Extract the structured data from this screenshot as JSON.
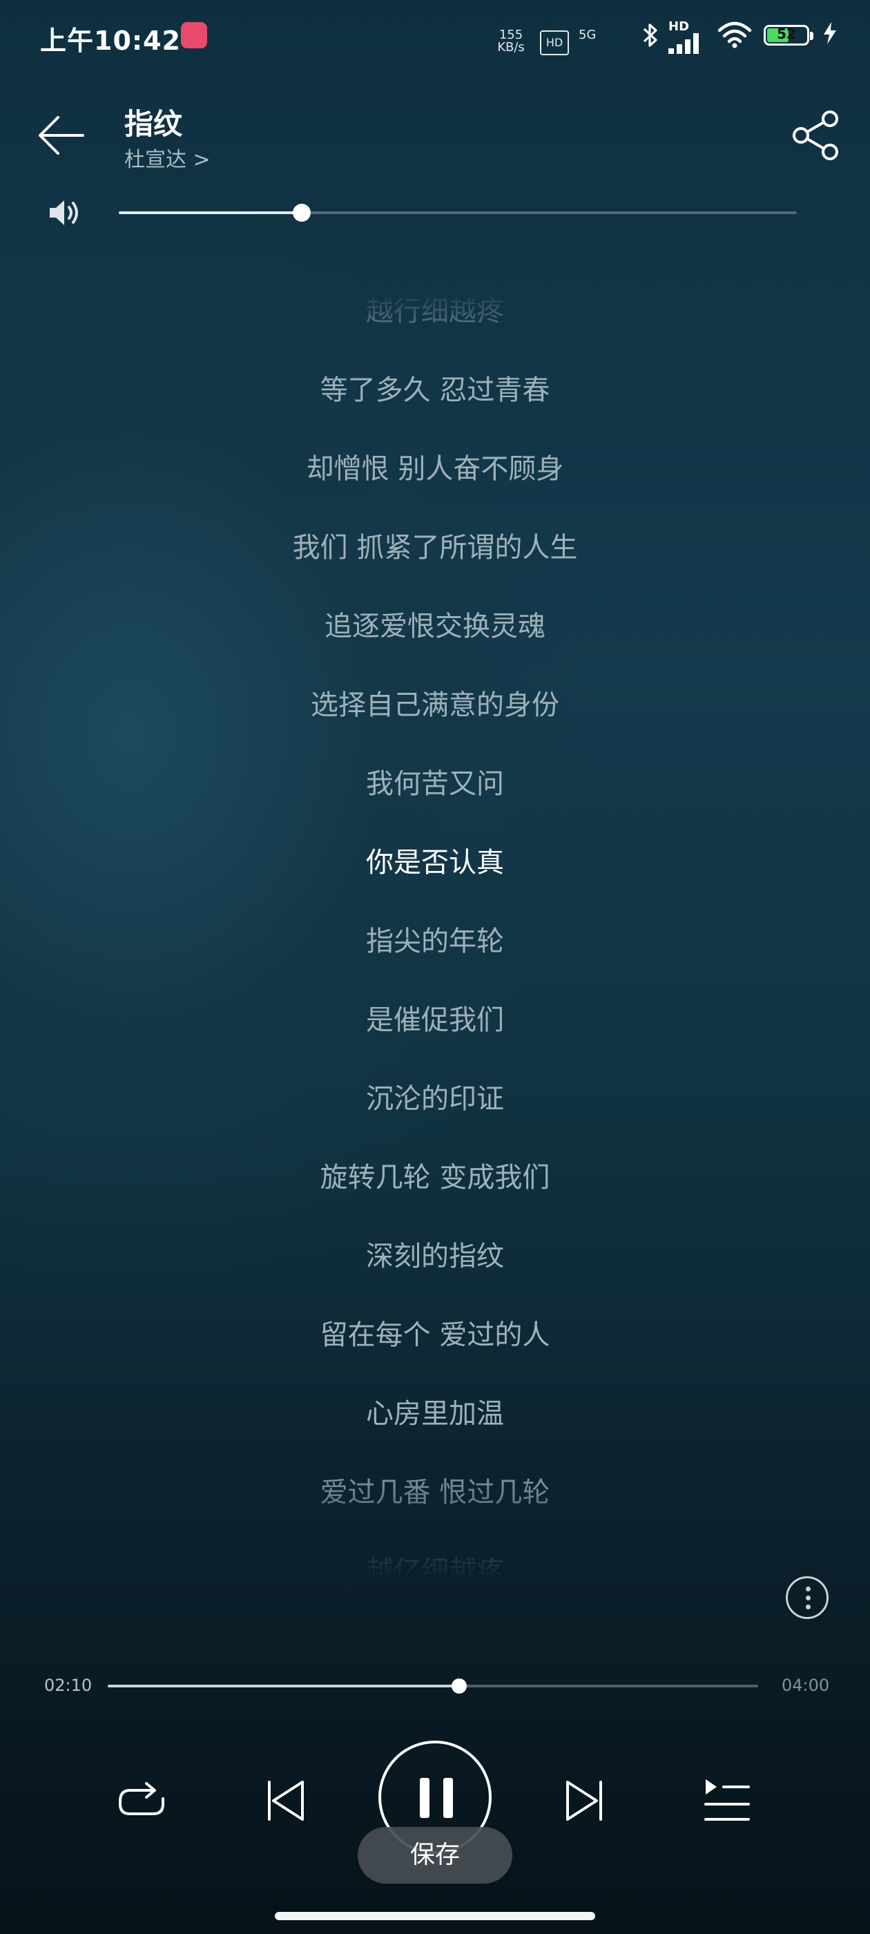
{
  "status_bar": {
    "time": "上午10:42",
    "net_speed": "155",
    "net_unit": "KB/s",
    "hd1": "HD",
    "signal_label": "5G",
    "hd2": "HD",
    "battery": "52",
    "battery_level": 0.52,
    "icons": [
      "app-notification-icon",
      "hd-volte-icon",
      "bluetooth-icon",
      "signal-icon",
      "wifi-icon",
      "battery-icon",
      "charging-icon"
    ]
  },
  "header": {
    "title": "指纹",
    "artist": "杜宣达 >"
  },
  "volume": {
    "level": 0.27
  },
  "lyrics": {
    "lines": [
      "越行细越疼",
      "等了多久 忍过青春",
      "却憎恨 别人奋不顾身",
      "我们 抓紧了所谓的人生",
      "追逐爱恨交换灵魂",
      "选择自己满意的身份",
      "我何苦又问",
      "你是否认真",
      "指尖的年轮",
      "是催促我们",
      "沉沦的印证",
      "旋转几轮 变成我们",
      "深刻的指纹",
      "留在每个 爱过的人",
      "心房里加温",
      "爱过几番 恨过几轮",
      "越亿细越疼"
    ],
    "current_index": 7
  },
  "progress": {
    "current": "02:10",
    "total": "04:00",
    "fraction": 0.54
  },
  "controls": {
    "repeat": "repeat-icon",
    "previous": "previous-icon",
    "play_pause": "pause-icon",
    "next": "next-icon",
    "playlist": "playlist-icon"
  },
  "toast": {
    "label": "保存"
  }
}
